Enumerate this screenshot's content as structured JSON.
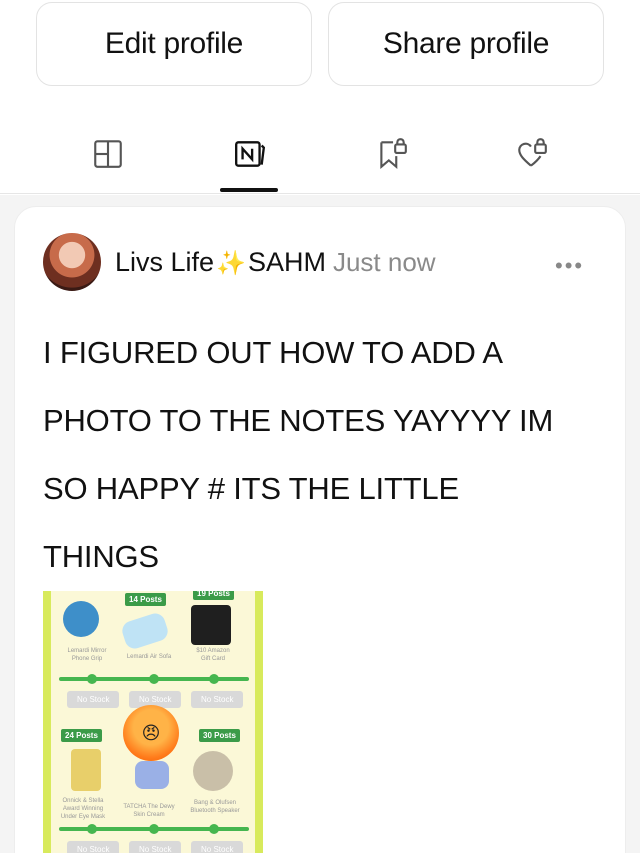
{
  "profile_actions": {
    "edit_label": "Edit profile",
    "share_label": "Share profile"
  },
  "tabs": [
    {
      "icon": "grid-icon",
      "active": false
    },
    {
      "icon": "notes-icon",
      "active": true
    },
    {
      "icon": "saved-bookmark-lock-icon",
      "active": false
    },
    {
      "icon": "liked-heart-lock-icon",
      "active": false
    }
  ],
  "post": {
    "author": "Livs Life",
    "sparkle": "✨",
    "author_suffix": "SAHM",
    "time": "Just now",
    "more": "•••",
    "lines": [
      "I FIGURED OUT HOW TO ADD A",
      "PHOTO TO THE NOTES YAYYYY IM",
      "SO HAPPY # ITS THE LITTLE",
      "THINGS"
    ],
    "photo": {
      "tags": [
        "14 Posts",
        "19 Posts",
        "24 Posts",
        "30 Posts"
      ],
      "chips": [
        "No Stock",
        "No Stock",
        "No Stock",
        "No Stock",
        "No Stock",
        "No Stock"
      ],
      "captions": [
        "Lemardi Mirror\nPhone Grip",
        "Lemardi Air Sofa",
        "$10 Amazon\nGift Card",
        "Onnick & Stella\nAward Winning\nUnder Eye Mask",
        "TATCHA The Dewy\nSkin Cream",
        "Bang & Olufsen\nBluetooth Speaker"
      ],
      "emoji": "😠"
    }
  }
}
